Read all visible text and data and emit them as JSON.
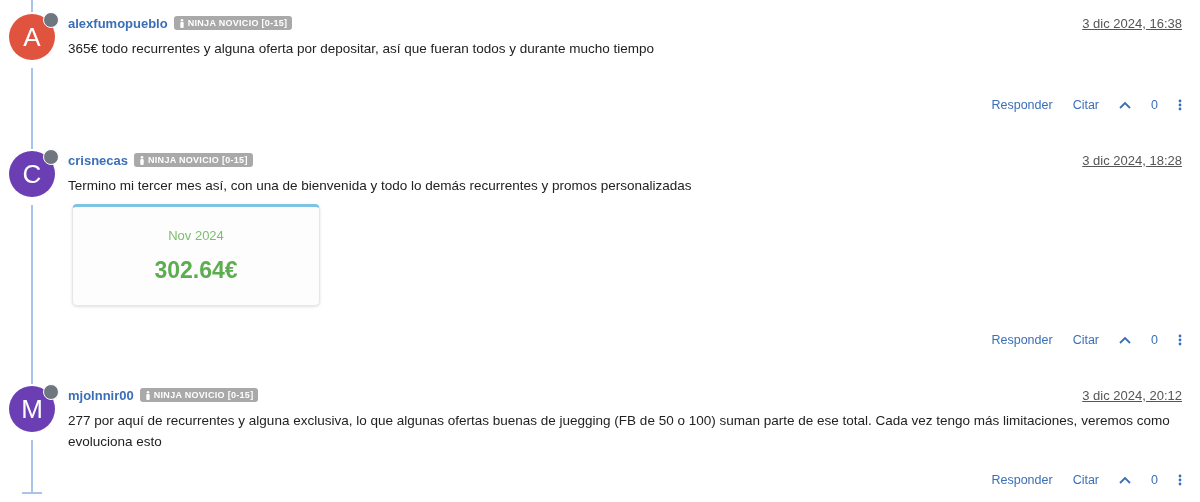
{
  "comments": [
    {
      "initial": "A",
      "color": "#e0533f",
      "online": false,
      "author": "alexfumopueblo",
      "badge": "NINJA NOVICIO [0-15]",
      "date": "3 dic 2024, 16:38",
      "text": "365€ todo recurrentes y alguna oferta por depositar, así que fueran todos y durante mucho tiempo",
      "actions": {
        "reply": "Responder",
        "quote": "Citar",
        "votes": "0"
      }
    },
    {
      "initial": "C",
      "color": "#6b3fb3",
      "online": false,
      "author": "crisnecas",
      "badge": "NINJA NOVICIO [0-15]",
      "date": "3 dic 2024, 18:28",
      "text": "Termino mi tercer mes así, con una de bienvenida y todo lo demás recurrentes y promos personalizadas",
      "attachment": {
        "month": "Nov 2024",
        "amount": "302.64€"
      },
      "actions": {
        "reply": "Responder",
        "quote": "Citar",
        "votes": "0"
      }
    },
    {
      "initial": "M",
      "color": "#6b3fb3",
      "online": false,
      "author": "mjolnnir00",
      "badge": "NINJA NOVICIO [0-15]",
      "date": "3 dic 2024, 20:12",
      "text": "277 por aquí de recurrentes y alguna exclusiva, lo que algunas ofertas buenas de juegging (FB de 50 o 100) suman parte de ese total. Cada vez tengo más limitaciones, veremos como evoluciona esto",
      "actions": {
        "reply": "Responder",
        "quote": "Citar",
        "votes": "0"
      }
    }
  ]
}
